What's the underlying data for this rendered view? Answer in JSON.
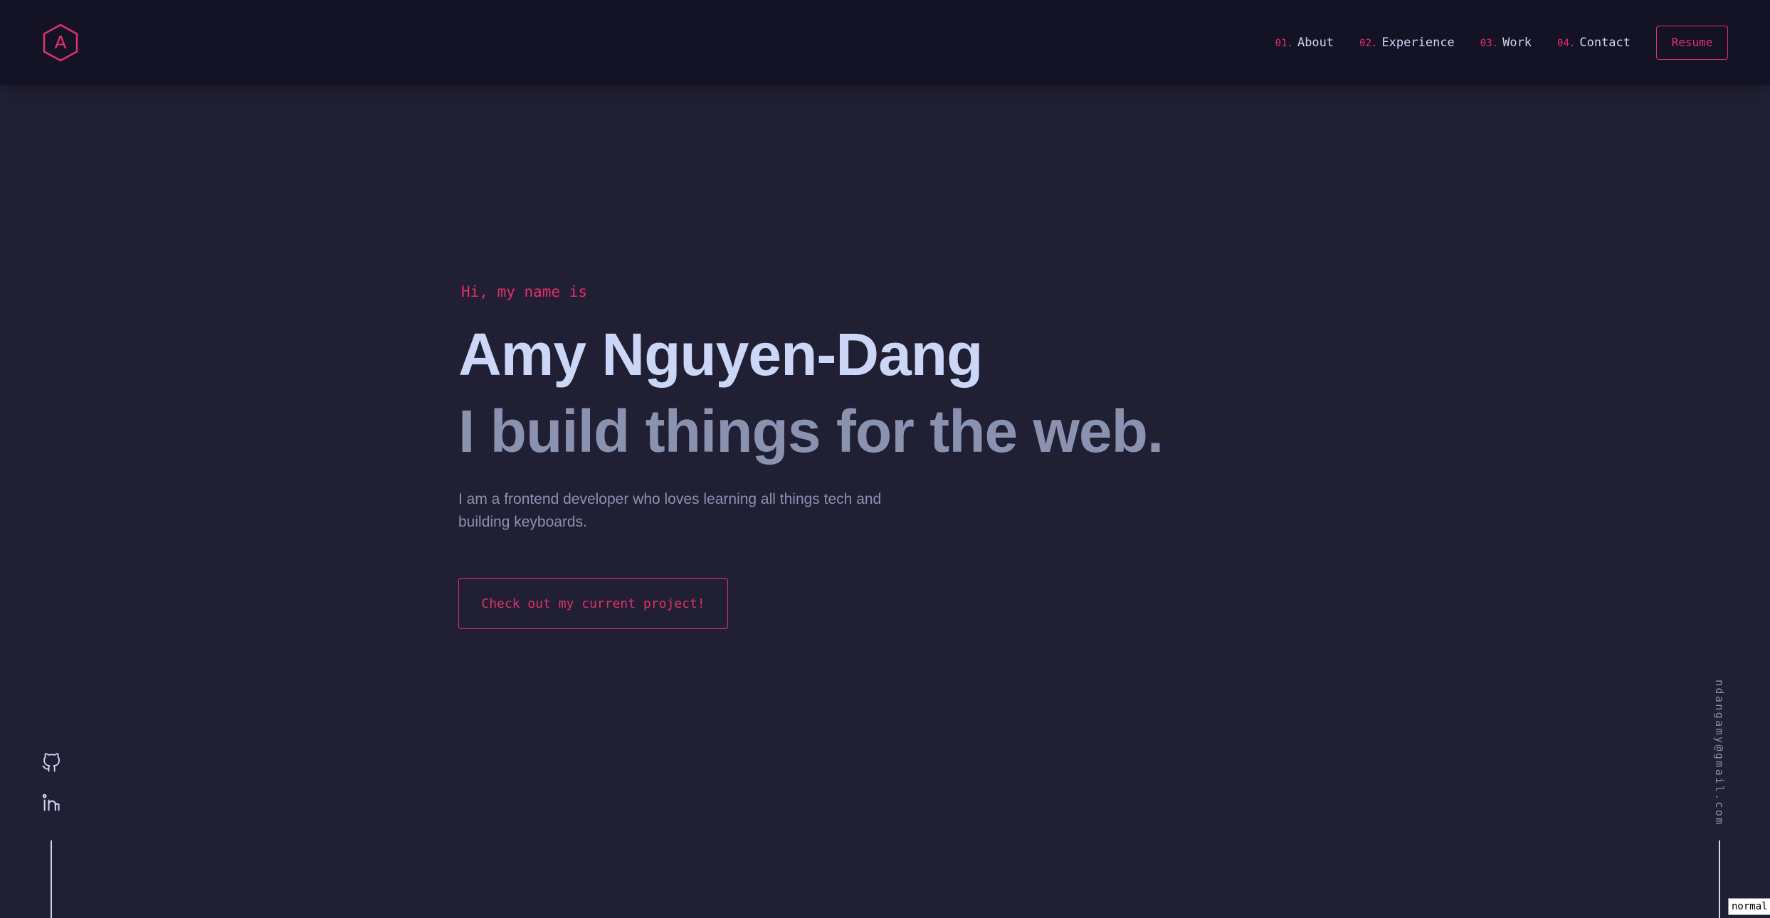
{
  "theme": {
    "accent": "#e2306c",
    "background": "#201f33",
    "header_background": "#141326",
    "heading_color": "#ccd6f6",
    "muted_color": "#8b92b0"
  },
  "header": {
    "logo": {
      "letter": "A",
      "icon": "hexagon-logo-icon"
    },
    "nav": [
      {
        "number": "01.",
        "label": "About"
      },
      {
        "number": "02.",
        "label": "Experience"
      },
      {
        "number": "03.",
        "label": "Work"
      },
      {
        "number": "04.",
        "label": "Contact"
      }
    ],
    "resume_label": "Resume"
  },
  "hero": {
    "greeting": "Hi, my name is",
    "name": "Amy Nguyen-Dang",
    "tagline": "I build things for the web.",
    "intro_line1": "I am a frontend developer who loves learning all things tech and",
    "intro_line2": "building keyboards.",
    "cta_label": "Check out my current project!"
  },
  "social": [
    {
      "icon": "github-icon"
    },
    {
      "icon": "linkedin-icon"
    }
  ],
  "email": "ndangamy@gmail.com",
  "mode_badge": "normal"
}
